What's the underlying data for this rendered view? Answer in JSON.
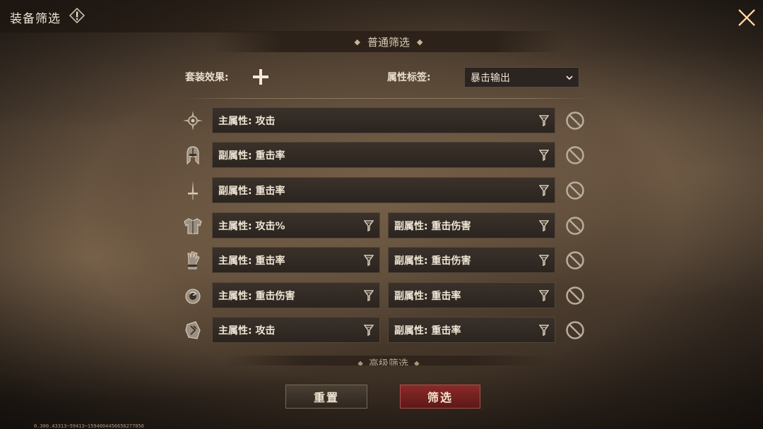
{
  "title": "装备筛选",
  "section_normal": "普通筛选",
  "section_advanced": "高级筛选",
  "set_effect_label": "套装效果:",
  "attr_tag_label": "属性标签:",
  "attr_tag_value": "暴击输出",
  "rows": [
    {
      "slot": "amulet-icon",
      "left": "主属性: 攻击",
      "right": null
    },
    {
      "slot": "helmet-icon",
      "left": "副属性: 重击率",
      "right": null
    },
    {
      "slot": "weapon-icon",
      "left": "副属性: 重击率",
      "right": null
    },
    {
      "slot": "armor-icon",
      "left": "主属性: 攻击%",
      "right": "副属性: 重击伤害"
    },
    {
      "slot": "gauntlet-icon",
      "left": "主属性: 重击率",
      "right": "副属性: 重击伤害"
    },
    {
      "slot": "ring-icon",
      "left": "主属性: 重击伤害",
      "right": "副属性: 重击率"
    },
    {
      "slot": "rune-icon",
      "left": "主属性: 攻击",
      "right": "副属性: 重击率"
    }
  ],
  "buttons": {
    "reset": "重置",
    "filter": "筛选"
  },
  "version": "0.300.43313~59413~1594004456656277056",
  "colors": {
    "accent_red": "#8a2a2a",
    "text": "#efe6d5",
    "field_bg": "#2b241f"
  }
}
